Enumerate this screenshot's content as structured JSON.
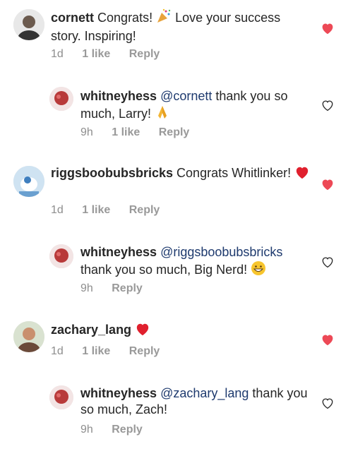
{
  "comments": [
    {
      "username": "cornett",
      "text": "Congrats!",
      "text_after": "Love your success story. Inspiring!",
      "time": "1d",
      "likes": "1 like",
      "reply_label": "Reply",
      "liked": true,
      "replies": [
        {
          "username": "whitneyhess",
          "mention": "@cornett",
          "text": "thank you so much, Larry!",
          "time": "9h",
          "likes": "1 like",
          "reply_label": "Reply",
          "liked": false
        }
      ]
    },
    {
      "username": "riggsboobubsbricks",
      "text": "Congrats Whitlinker!",
      "time": "1d",
      "likes": "1 like",
      "reply_label": "Reply",
      "liked": true,
      "replies": [
        {
          "username": "whitneyhess",
          "mention": "@riggsboobubsbricks",
          "text": "thank you so much, Big Nerd!",
          "time": "9h",
          "likes": "",
          "reply_label": "Reply",
          "liked": false
        }
      ]
    },
    {
      "username": "zachary_lang",
      "text": "",
      "time": "1d",
      "likes": "1 like",
      "reply_label": "Reply",
      "liked": true,
      "replies": [
        {
          "username": "whitneyhess",
          "mention": "@zachary_lang",
          "text": "thank you so much, Zach!",
          "time": "9h",
          "likes": "",
          "reply_label": "Reply",
          "liked": false
        }
      ]
    }
  ],
  "colors": {
    "like_red": "#ed4956",
    "meta_gray": "#8e8e8e",
    "mention_blue": "#1e3a6e"
  }
}
